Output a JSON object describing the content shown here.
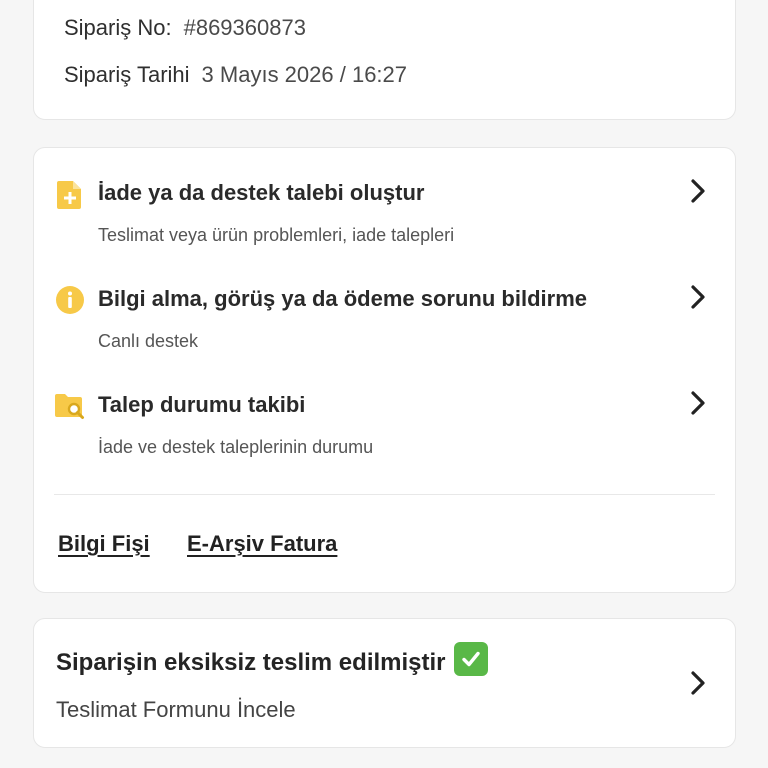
{
  "order": {
    "number_label": "Sipariş No:",
    "number_value": "#869360873",
    "date_label": "Sipariş Tarihi",
    "date_value": "3 Mayıs 2026 / 16:27"
  },
  "help_menu": {
    "items": [
      {
        "title": "İade ya da destek talebi oluştur",
        "subtitle": "Teslimat veya ürün problemleri, iade talepleri",
        "icon": "document-plus-icon"
      },
      {
        "title": "Bilgi alma, görüş ya da ödeme sorunu bildirme",
        "subtitle": "Canlı destek",
        "icon": "info-icon"
      },
      {
        "title": "Talep durumu takibi",
        "subtitle": "İade ve destek taleplerinin durumu",
        "icon": "folder-search-icon"
      }
    ],
    "links": {
      "info_slip": "Bilgi Fişi",
      "invoice": "E-Arşiv Fatura"
    }
  },
  "delivery": {
    "title": "Siparişin eksiksiz teslim edilmiştir",
    "subtitle": "Teslimat Formunu İncele",
    "icon": "check-mark-emoji-icon"
  },
  "colors": {
    "accent_yellow": "#f7c948",
    "check_green": "#59b847",
    "text_dark": "#2a2a2a",
    "background": "#f6f6f6"
  }
}
